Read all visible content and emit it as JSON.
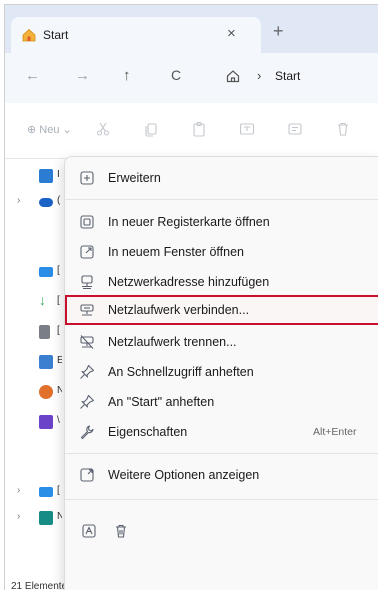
{
  "window": {
    "tab_title": "Start",
    "tab_close": "×",
    "new_tab": "+"
  },
  "address": {
    "back": "←",
    "forward": "→",
    "up": "↑",
    "refresh": "C",
    "separator": "›",
    "location": "Start"
  },
  "commandbar": {
    "new_label": "⊕ Neu ⌄"
  },
  "navpane": {
    "items": [
      {
        "chevron": "",
        "color": "#2b7cd3",
        "cut": "I"
      },
      {
        "chevron": "›",
        "color": "#1c63c7",
        "cut": "("
      },
      {
        "chevron": "",
        "color": "#2a8ee6",
        "cut": "["
      },
      {
        "chevron": "",
        "color": "#3ba75c",
        "cut": "["
      },
      {
        "chevron": "",
        "color": "#7a7f87",
        "cut": "["
      },
      {
        "chevron": "",
        "color": "#3b7fd0",
        "cut": "E"
      },
      {
        "chevron": "",
        "color": "#e0702a",
        "cut": "N"
      },
      {
        "chevron": "",
        "color": "#6a43c9",
        "cut": "\\"
      },
      {
        "chevron": "›",
        "color": "#2a8ee6",
        "cut": "["
      },
      {
        "chevron": "›",
        "color": "#178c86",
        "cut": "N"
      }
    ]
  },
  "status": {
    "count": "21 Elemente"
  },
  "menu": {
    "items": [
      {
        "label": "Erweitern",
        "icon": "expand-icon"
      },
      {
        "label": "In neuer Registerkarte öffnen",
        "icon": "new-tab-icon"
      },
      {
        "label": "In neuem Fenster öffnen",
        "icon": "new-window-icon"
      },
      {
        "label": "Netzwerkadresse hinzufügen",
        "icon": "network-location-icon"
      },
      {
        "label": "Netzlaufwerk verbinden...",
        "icon": "map-network-drive-icon"
      },
      {
        "label": "Netzlaufwerk trennen...",
        "icon": "disconnect-drive-icon"
      },
      {
        "label": "An Schnellzugriff anheften",
        "icon": "pin-icon"
      },
      {
        "label": "An \"Start\" anheften",
        "icon": "pin-icon"
      },
      {
        "label": "Eigenschaften",
        "icon": "properties-icon",
        "shortcut": "Alt+Enter"
      },
      {
        "label": "Weitere Optionen anzeigen",
        "icon": "more-options-icon"
      }
    ]
  },
  "colors": {
    "accent": "#c8102e",
    "tabstrip": "#dfe8f4",
    "icon": "#5a6270"
  }
}
